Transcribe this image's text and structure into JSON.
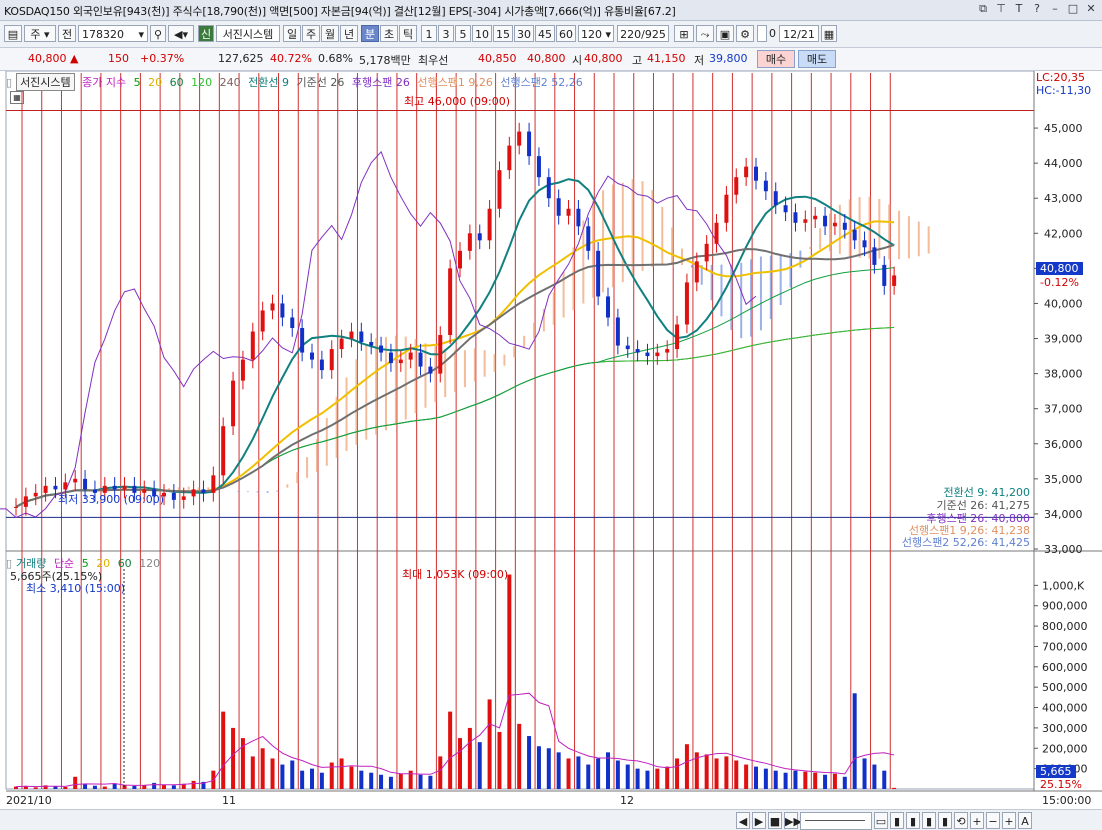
{
  "titlebar": {
    "text": "KOSDAQ150 외국인보유[943(천)] 주식수[18,790(천)] 액면[500] 자본금[94(억)] 결산[12월] EPS[-304] 시가총액[7,666(억)] 유통비율[67.2]"
  },
  "toolbar": {
    "market": "주",
    "all": "전",
    "code": "178320",
    "shin_label": "신",
    "system": "서진시스템",
    "periods": [
      "일",
      "주",
      "월",
      "년",
      "분",
      "초",
      "틱"
    ],
    "selected_period": "분",
    "intervals": [
      "1",
      "3",
      "5",
      "10",
      "15",
      "30",
      "45",
      "60"
    ],
    "interval_value": "120",
    "count": "220",
    "total": "/925",
    "date_prefix": "0",
    "date": "12/21"
  },
  "quote": {
    "price": "40,800",
    "change": "150",
    "pct": "+0.37%",
    "volume": "127,625",
    "ratio1": "40.72%",
    "ratio2": "0.68%",
    "amount": "5,178백만",
    "best_label": "최우선",
    "best_ask": "40,850",
    "best_bid": "40,800",
    "open_label": "시",
    "open": "40,800",
    "high_label": "고",
    "high": "41,150",
    "low_label": "저",
    "low": "39,800",
    "buy": "매수",
    "sell": "매도"
  },
  "price_panel": {
    "legend": {
      "system": "서진시스템",
      "ma_label": "종가 지수",
      "ma": [
        "5",
        "20",
        "60",
        "120",
        "240"
      ],
      "ichimoku": [
        "전환선 9",
        "기준선 26",
        "후행스팬 26",
        "선행스팬1 9,26",
        "선행스팬2 52,26"
      ]
    },
    "lc": "LC:20,35",
    "hc": "HC:-11,30",
    "max_label": "최고 46,000 (09:00)",
    "min_label": "최저 33,900 (09:00)",
    "current_price": "40,800",
    "current_pct": "-0.12%",
    "ichimoku_values": [
      "전환선 9: 41,200",
      "기준선 26: 41,275",
      "후행스팬 26: 40,800",
      "선행스팬1 9,26: 41,238",
      "선행스팬2 52,26: 41,425"
    ],
    "colors": {
      "up": "#e01010",
      "down": "#1030c8",
      "ma5": "#00a000",
      "ma20": "#f0c000",
      "ma60": "#10a040",
      "ma120": "#30c030",
      "ma240": "#806060",
      "tenkan": "#108080",
      "kijun": "#707070",
      "chikou": "#8030c0",
      "span1": "#f0a070",
      "span2": "#7090e0"
    }
  },
  "volume_panel": {
    "legend": {
      "label": "거래량",
      "ma_label": "단순",
      "ma": [
        "5",
        "20",
        "60",
        "120"
      ]
    },
    "current_label": "5,665주(25.15%)",
    "min_label": "최소 3,410 (15:00)",
    "max_label": "최대 1,053K (09:00)",
    "current_value": "5,665",
    "current_pct": "25.15%"
  },
  "x_axis": {
    "labels": [
      "2021/10",
      "11",
      "12"
    ],
    "time": "15:00:00"
  },
  "chart_data": [
    {
      "type": "candlestick",
      "ylim": [
        33000,
        46000
      ],
      "y_ticks": [
        33000,
        34000,
        35000,
        36000,
        37000,
        38000,
        39000,
        40000,
        41000,
        42000,
        43000,
        44000,
        45000
      ],
      "y_tick_labels": [
        "33,000",
        "34,000",
        "35,000",
        "36,000",
        "37,000",
        "38,000",
        "39,000",
        "40,000",
        "41,000",
        "42,000",
        "43,000",
        "44,000",
        "45,000"
      ],
      "close": [
        34200,
        34500,
        34600,
        34800,
        34700,
        34900,
        35000,
        34700,
        34600,
        34800,
        34700,
        34800,
        34600,
        34700,
        34500,
        34600,
        34400,
        34500,
        34700,
        34600,
        35100,
        36500,
        37800,
        38400,
        39200,
        39800,
        40000,
        39600,
        39300,
        38600,
        38400,
        38100,
        38700,
        39000,
        39200,
        38900,
        38800,
        38600,
        38300,
        38400,
        38600,
        38200,
        38000,
        39100,
        41000,
        41500,
        42000,
        41800,
        42700,
        43800,
        44500,
        44900,
        44200,
        43600,
        43000,
        42500,
        42700,
        42200,
        41500,
        40200,
        39600,
        38800,
        38700,
        38600,
        38500,
        38600,
        38700,
        39400,
        40600,
        41200,
        41700,
        42300,
        43100,
        43600,
        43900,
        43500,
        43200,
        42800,
        42600,
        42300,
        42400,
        42500,
        42200,
        42300,
        42100,
        41800,
        41600,
        41100,
        40500,
        40800
      ]
    },
    {
      "type": "bar",
      "ylim": [
        0,
        1100000
      ],
      "y_ticks": [
        100000,
        200000,
        300000,
        400000,
        500000,
        600000,
        700000,
        800000,
        900000,
        1000000
      ],
      "y_tick_labels": [
        "100,000",
        "200,000",
        "300,000",
        "400,000",
        "500,000",
        "600,000",
        "700,000",
        "800,000",
        "900,000",
        "1,000,K"
      ],
      "values": [
        12000,
        15000,
        8000,
        18000,
        14000,
        10000,
        60000,
        22000,
        16000,
        12000,
        25000,
        20000,
        15000,
        18000,
        30000,
        22000,
        18000,
        26000,
        40000,
        35000,
        90000,
        380000,
        300000,
        250000,
        160000,
        200000,
        150000,
        120000,
        140000,
        90000,
        100000,
        80000,
        130000,
        150000,
        110000,
        90000,
        80000,
        70000,
        60000,
        75000,
        90000,
        70000,
        65000,
        160000,
        380000,
        250000,
        300000,
        230000,
        440000,
        280000,
        1053000,
        320000,
        260000,
        210000,
        200000,
        180000,
        150000,
        160000,
        120000,
        150000,
        180000,
        140000,
        120000,
        100000,
        90000,
        100000,
        110000,
        150000,
        220000,
        180000,
        170000,
        150000,
        160000,
        140000,
        120000,
        110000,
        100000,
        90000,
        80000,
        90000,
        85000,
        80000,
        70000,
        75000,
        60000,
        470000,
        150000,
        120000,
        90000,
        5665
      ]
    }
  ]
}
